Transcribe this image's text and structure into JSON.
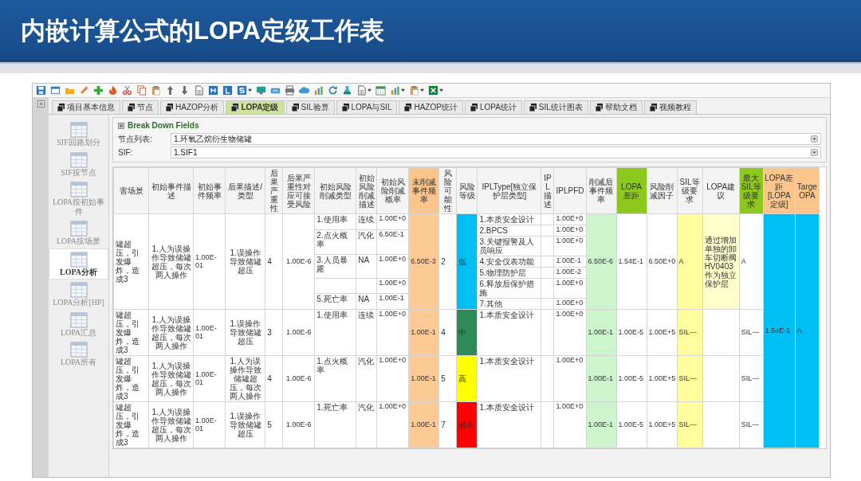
{
  "slide_title": "内嵌计算公式的LOPA定级工作表",
  "tabs": [
    {
      "label": "项目基本信息",
      "selected": false
    },
    {
      "label": "节点",
      "selected": false
    },
    {
      "label": "HAZOP分析",
      "selected": false
    },
    {
      "label": "LOPA定级",
      "selected": true
    },
    {
      "label": "SIL验算",
      "selected": false
    },
    {
      "label": "LOPA与SIL",
      "selected": false
    },
    {
      "label": "HAZOP统计",
      "selected": false
    },
    {
      "label": "LOPA统计",
      "selected": false
    },
    {
      "label": "SIL统计图表",
      "selected": false
    },
    {
      "label": "帮助文档",
      "selected": false
    },
    {
      "label": "视频教程",
      "selected": false
    }
  ],
  "sidebar": {
    "items": [
      {
        "label": "SIF回路划分",
        "selected": false
      },
      {
        "label": "SIF按节点",
        "selected": false
      },
      {
        "label": "LOPA按初始事件",
        "selected": false
      },
      {
        "label": "LOPA按场景",
        "selected": false
      },
      {
        "label": "LOPA分析",
        "selected": true
      },
      {
        "label": "LOPA分析[HP]",
        "selected": false
      },
      {
        "label": "LOPA汇总",
        "selected": false
      },
      {
        "label": "LOPA所有",
        "selected": false
      }
    ]
  },
  "panel": {
    "title": "Break Down Fields",
    "fields": [
      {
        "label": "节点列表:",
        "value": "1.环氧乙烷衍生物储罐"
      },
      {
        "label": "SIF:",
        "value": "1.SIF1"
      }
    ]
  },
  "table": {
    "columns": [
      {
        "label": "害场景"
      },
      {
        "label": "初始事件描述"
      },
      {
        "label": "初始事件频率"
      },
      {
        "label": "后果描述/类型"
      },
      {
        "label": "后果严重性"
      },
      {
        "label": "后果严重性对应可接受风险"
      },
      {
        "label": "初始风险削减类型"
      },
      {
        "label": "初始风险削减描述"
      },
      {
        "label": "初始风险削减概率"
      },
      {
        "label": "未削减事件频率",
        "color": "#fbc58b"
      },
      {
        "label": "风险可能性"
      },
      {
        "label": "风险等级"
      },
      {
        "label": "IPLType[独立保护层类型]"
      },
      {
        "label": "IPL描述"
      },
      {
        "label": "IPLPFD"
      },
      {
        "label": "削减后事件频率"
      },
      {
        "label": "LOPA差距",
        "color": "#8cc81e"
      },
      {
        "label": "风险削减因子"
      },
      {
        "label": "SIL等级要求"
      },
      {
        "label": "LOPA建议"
      },
      {
        "label": "最大SIL等级要求",
        "color": "#8cc81e"
      },
      {
        "label": "LOPA差距[LOPA定级]",
        "color": "#fbc58b"
      },
      {
        "label": "Targe OPA",
        "color": "#fbc58b"
      }
    ],
    "rows": [
      {
        "scenario": "罐超压，引发爆炸，造成3",
        "initiating_event": "1.人为误操作导致储罐超压，每次两人操作",
        "initiating_frequency": "1.00E-01",
        "consequence": "1.误操作导致储罐超压",
        "severity": "4",
        "acceptable_risk": "1.00E-6",
        "mitigations": [
          {
            "type": "1.使用率",
            "description": "连续",
            "probability": "1.00E+0"
          },
          {
            "type": "2.点火概率",
            "description": "汽化",
            "probability": "6.50E-1"
          },
          {
            "type": "3.人员暴露",
            "description": "NA",
            "probability": "1.00E+0"
          },
          {
            "probability": "1.00E+0"
          },
          {
            "type": "5.死亡率",
            "description": "NA",
            "probability": "1.00E-1"
          }
        ],
        "unmitigated_frequency": "6.50E-3",
        "likelihood": "2",
        "risk_level": {
          "label": "低",
          "color": "#00bff3"
        },
        "ipls": [
          {
            "type": "1.本质安全设计",
            "pfd": "1.00E+0"
          },
          {
            "type": "2.BPCS",
            "pfd": "1.00E+0"
          },
          {
            "type": "3.关键报警及人员响应",
            "pfd": "1.00E+0"
          },
          {
            "type": "4.安全仪表功能",
            "pfd": "1.00E-1"
          },
          {
            "type": "5.物理防护层",
            "pfd": "1.00E-2"
          },
          {
            "type": "6.释放后保护措施",
            "pfd": "1.00E+0"
          },
          {
            "type": "7.其他",
            "pfd": "1.00E+0"
          }
        ],
        "mitigated_frequency": "6.50E-6",
        "lopa_gap": "1.54E-1",
        "risk_reduction_factor": "6.50E+0",
        "sil_requirement": "A",
        "lopa_recommendation": "通过增加单独的卸车切断阀HV0403作为独立保护层",
        "max_sil": "A"
      },
      {
        "scenario": "罐超压，引发爆炸，造成3",
        "initiating_event": "1.人为误操作导致储罐超压，每次两人操作",
        "initiating_frequency": "1.00E-01",
        "consequence": "1.误操作导致储罐超压",
        "severity": "3",
        "acceptable_risk": "1.00E-6",
        "mitigations": [
          {
            "type": "1.使用率",
            "description": "连续",
            "probability": "1.00E+0"
          }
        ],
        "unmitigated_frequency": "1.00E-1",
        "likelihood": "4",
        "risk_level": {
          "label": "中",
          "color": "#2e8b57"
        },
        "ipls": [
          {
            "type": "1.本质安全设计",
            "pfd": "1.00E+0"
          }
        ],
        "mitigated_frequency": "1.00E-1",
        "lopa_gap": "1.00E-5",
        "risk_reduction_factor": "1.00E+5",
        "sil_requirement": "SIL---",
        "max_sil": "SIL---"
      },
      {
        "scenario": "罐超压，引发爆炸，造成3",
        "initiating_event": "1.人为误操作导致储罐超压，每次两人操作",
        "initiating_frequency": "1.00E-01",
        "consequence": "1.人为误操作导致储罐超压，每次两人操作",
        "severity": "4",
        "acceptable_risk": "1.00E-6",
        "mitigations": [
          {
            "type": "1.点火概率",
            "description": "汽化",
            "probability": "1.00E+0"
          }
        ],
        "unmitigated_frequency": "1.00E-1",
        "likelihood": "5",
        "risk_level": {
          "label": "高",
          "color": "#ffff00"
        },
        "ipls": [
          {
            "type": "1.本质安全设计",
            "pfd": "1.00E+0"
          }
        ],
        "mitigated_frequency": "1.00E-1",
        "lopa_gap": "1.00E-5",
        "risk_reduction_factor": "1.00E+5",
        "sil_requirement": "SIL---",
        "max_sil": "SIL---"
      },
      {
        "scenario": "罐超压，引发爆炸，造成3",
        "initiating_event": "1.人为误操作导致储罐超压，每次两人操作",
        "initiating_frequency": "1.00E-01",
        "consequence": "1.误操作导致储罐超压",
        "severity": "5",
        "acceptable_risk": "1.00E-6",
        "mitigations": [
          {
            "type": "1.死亡率",
            "description": "汽化",
            "probability": "1.00E+0"
          }
        ],
        "unmitigated_frequency": "1.00E-1",
        "likelihood": "7",
        "risk_level": {
          "label": "极高",
          "color": "#ff0000"
        },
        "ipls": [
          {
            "type": "1.本质安全设计",
            "pfd": "1.00E+0"
          }
        ],
        "mitigated_frequency": "1.00E-1",
        "lopa_gap": "1.00E-5",
        "risk_reduction_factor": "1.00E+5",
        "sil_requirement": "SIL---",
        "max_sil": "SIL---"
      }
    ],
    "merged_values": [
      "1.54E-1",
      "A"
    ]
  }
}
